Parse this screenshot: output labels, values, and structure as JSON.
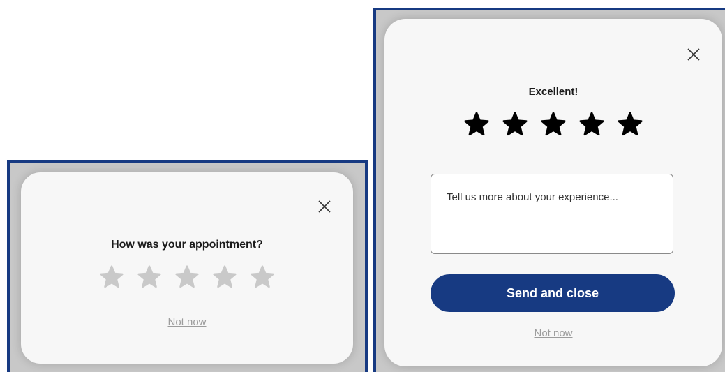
{
  "colors": {
    "frame_border": "#173a82",
    "button_bg": "#173a82",
    "star_empty": "#c9c9c9",
    "star_filled": "#000000",
    "link": "#9c9c9c"
  },
  "left_dialog": {
    "title": "How was your appointment?",
    "rating": 0,
    "max_rating": 5,
    "close_icon": "close-icon",
    "not_now_label": "Not now"
  },
  "right_dialog": {
    "title": "Excellent!",
    "rating": 5,
    "max_rating": 5,
    "close_icon": "close-icon",
    "feedback_placeholder": "Tell us more about your experience...",
    "send_button_label": "Send and close",
    "not_now_label": "Not now"
  }
}
